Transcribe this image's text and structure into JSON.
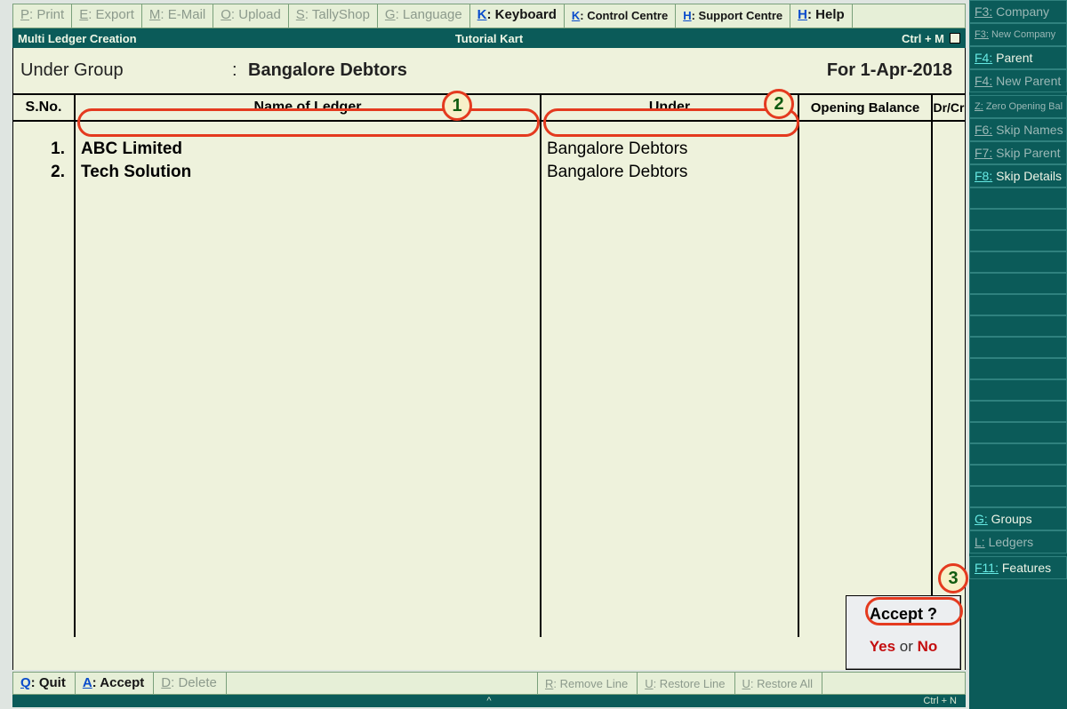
{
  "topmenu": [
    {
      "key": "P",
      "label": "Print",
      "state": "disabled"
    },
    {
      "key": "E",
      "label": "Export",
      "state": "disabled"
    },
    {
      "key": "M",
      "label": "E-Mail",
      "state": "disabled"
    },
    {
      "key": "O",
      "label": "Upload",
      "state": "disabled"
    },
    {
      "key": "S",
      "label": "TallyShop",
      "state": "disabled"
    },
    {
      "key": "G",
      "label": "Language",
      "state": "disabled"
    },
    {
      "key": "K",
      "label": "Keyboard",
      "state": "enabled"
    },
    {
      "key": "K",
      "label": "Control Centre",
      "state": "enabled",
      "small": true
    },
    {
      "key": "H",
      "label": "Support Centre",
      "state": "enabled",
      "small": true
    },
    {
      "key": "H",
      "label": "Help",
      "state": "enabled"
    }
  ],
  "strip": {
    "left": "Multi Ledger  Creation",
    "center": "Tutorial Kart",
    "right": "Ctrl + M"
  },
  "sub": {
    "label": "Under Group",
    "value": "Bangalore Debtors",
    "date": "For 1-Apr-2018"
  },
  "headers": {
    "sno": "S.No.",
    "name": "Name of Ledger",
    "under": "Under",
    "ob": "Opening Balance",
    "drcr": "Dr/Cr"
  },
  "rows": [
    {
      "sno": "1.",
      "name": "ABC Limited",
      "under": "Bangalore Debtors"
    },
    {
      "sno": "2.",
      "name": "Tech Solution",
      "under": "Bangalore Debtors"
    }
  ],
  "accept": {
    "q": "Accept ?",
    "yes": "Yes",
    "or": " or ",
    "no": "No"
  },
  "bottom": [
    {
      "key": "Q",
      "label": "Quit",
      "state": "enabled"
    },
    {
      "key": "A",
      "label": "Accept",
      "state": "enabled"
    },
    {
      "key": "D",
      "label": "Delete",
      "state": "disabled"
    },
    {
      "spacer": true
    },
    {
      "key": "R",
      "label": "Remove Line",
      "state": "disabled",
      "small": true
    },
    {
      "key": "U",
      "label": "Restore Line",
      "state": "disabled",
      "small": true
    },
    {
      "key": "U",
      "label": "Restore All",
      "state": "disabled",
      "small": true
    },
    {
      "spacer2": true
    }
  ],
  "calc": {
    "caret": "^",
    "right": "Ctrl + N"
  },
  "side": [
    {
      "fk": "F3:",
      "label": "Company",
      "state": "disabled"
    },
    {
      "fk": "F3:",
      "label": "New Company",
      "state": "disabled",
      "xs": true
    },
    {
      "fk": "F4:",
      "label": "Parent",
      "state": "active"
    },
    {
      "fk": "F4:",
      "label": "New Parent",
      "state": "disabled"
    },
    {
      "gap": true
    },
    {
      "fk": "Z:",
      "label": "Zero Opening Bal",
      "state": "disabled",
      "xs": true
    },
    {
      "fk": "F6:",
      "label": "Skip Names",
      "state": "disabled"
    },
    {
      "fk": "F7:",
      "label": "Skip Parent",
      "state": "disabled"
    },
    {
      "fk": "F8:",
      "label": "Skip Details",
      "state": "active"
    },
    {
      "empty": true
    },
    {
      "empty": true
    },
    {
      "empty": true
    },
    {
      "empty": true
    },
    {
      "empty": true
    },
    {
      "empty": true
    },
    {
      "empty": true
    },
    {
      "empty": true
    },
    {
      "empty": true
    },
    {
      "empty": true
    },
    {
      "empty": true
    },
    {
      "empty": true
    },
    {
      "empty": true
    },
    {
      "empty": true
    },
    {
      "empty": true
    },
    {
      "fk": "G:",
      "label": "Groups",
      "state": "active"
    },
    {
      "fk": "L:",
      "label": "Ledgers",
      "state": "disabled"
    },
    {
      "gap": true
    },
    {
      "fk": "F11:",
      "label": "Features",
      "state": "active"
    }
  ],
  "markers": {
    "1": "1",
    "2": "2",
    "3": "3"
  }
}
